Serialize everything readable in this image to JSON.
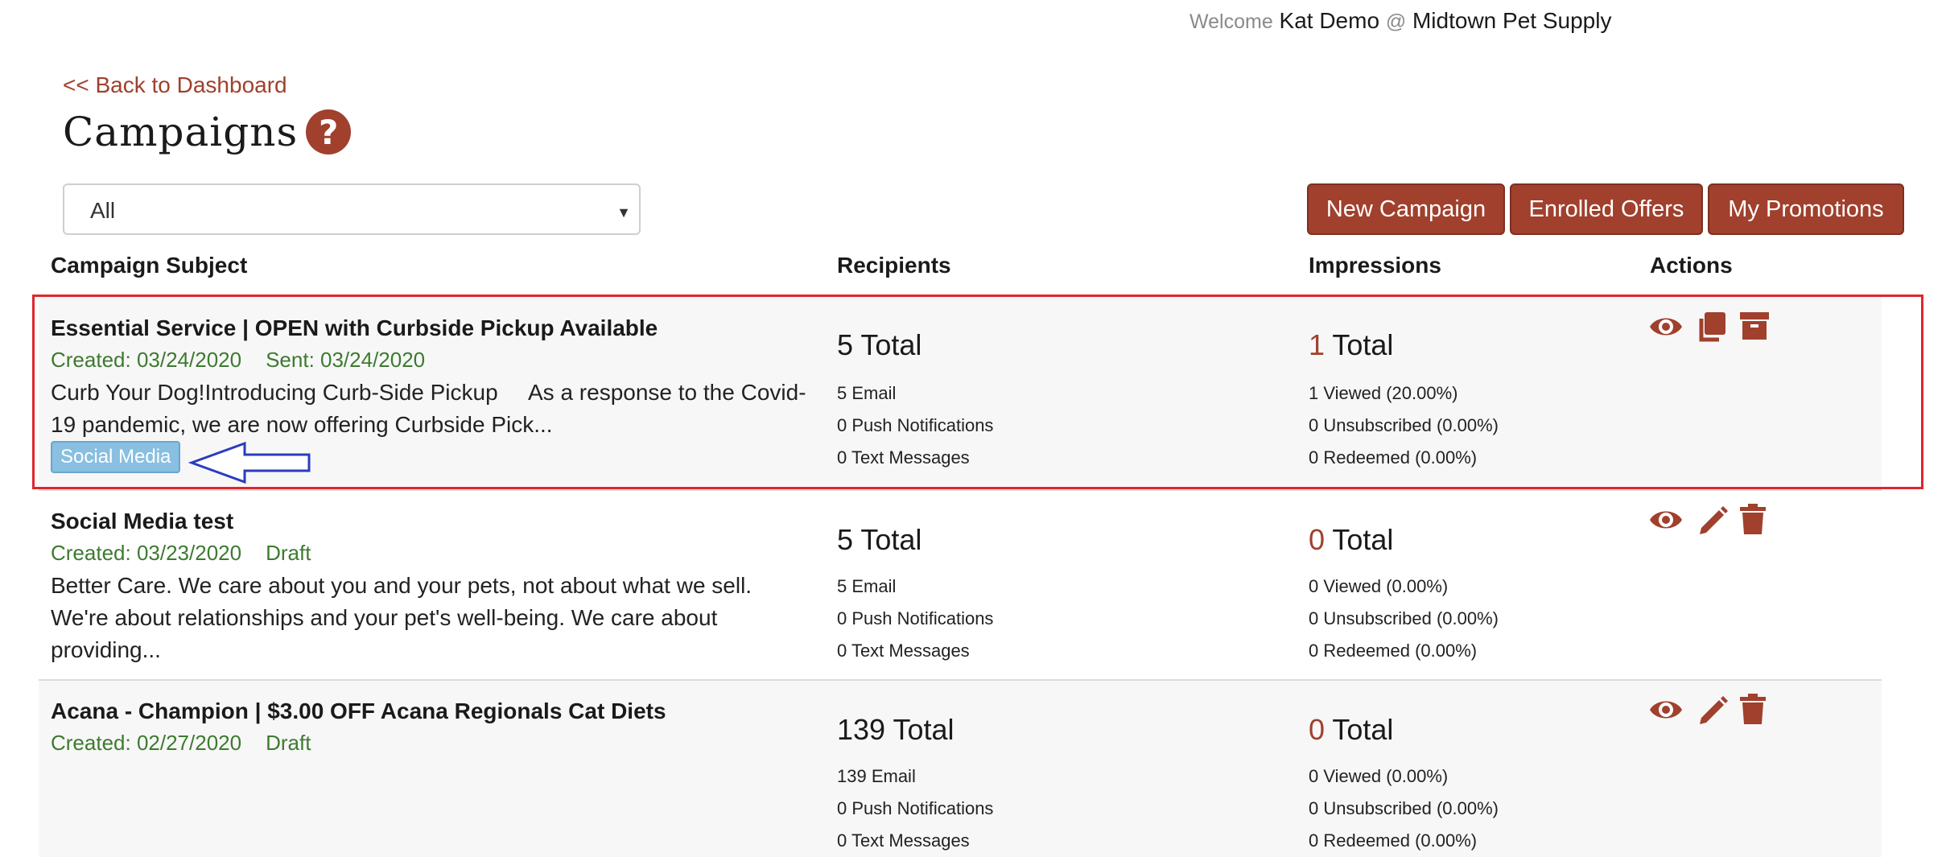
{
  "header": {
    "welcome_label": "Welcome",
    "user_name": "Kat Demo",
    "at_sign": "@",
    "store_name": "Midtown Pet Supply"
  },
  "nav": {
    "back_link": "<< Back to Dashboard"
  },
  "page": {
    "title": "Campaigns"
  },
  "filter": {
    "selected": "All"
  },
  "toolbar": {
    "new_campaign": "New Campaign",
    "enrolled_offers": "Enrolled Offers",
    "my_promotions": "My Promotions"
  },
  "columns": {
    "subject": "Campaign Subject",
    "recipients": "Recipients",
    "impressions": "Impressions",
    "actions": "Actions"
  },
  "campaigns": [
    {
      "subject": "Essential Service | OPEN with Curbside Pickup Available",
      "created": "Created: 03/24/2020",
      "status": "Sent: 03/24/2020",
      "preview_line1": "Curb Your Dog!Introducing Curb-Side Pickup     As a response to the Covid-",
      "preview_line2": "19 pandemic, we are now offering Curbside Pick...",
      "tag": "Social Media",
      "recipients_total_num": "5",
      "recipients_total_label": "Total",
      "email": "5 Email",
      "push": "0 Push Notifications",
      "text": "0 Text Messages",
      "impressions_total_num": "1",
      "impressions_total_label": "Total",
      "viewed": "1 Viewed (20.00%)",
      "unsubscribed": "0 Unsubscribed (0.00%)",
      "redeemed": "0 Redeemed (0.00%)",
      "actions": [
        "eye-icon",
        "copy-icon",
        "archive-icon"
      ]
    },
    {
      "subject": "Social Media test",
      "created": "Created: 03/23/2020",
      "status": "Draft",
      "preview_line1": "Better Care. We care about you and your pets, not about what we sell.",
      "preview_line2": "We're about relationships and your pet's well-being. We care about",
      "preview_line3": "providing...",
      "recipients_total_num": "5",
      "recipients_total_label": "Total",
      "email": "5 Email",
      "push": "0 Push Notifications",
      "text": "0 Text Messages",
      "impressions_total_num": "0",
      "impressions_total_label": "Total",
      "viewed": "0 Viewed (0.00%)",
      "unsubscribed": "0 Unsubscribed (0.00%)",
      "redeemed": "0 Redeemed (0.00%)",
      "actions": [
        "eye-icon",
        "pencil-icon",
        "trash-icon"
      ]
    },
    {
      "subject": "Acana - Champion | $3.00 OFF Acana Regionals Cat Diets",
      "created": "Created: 02/27/2020",
      "status": "Draft",
      "recipients_total_num": "139",
      "recipients_total_label": "Total",
      "email": "139 Email",
      "push": "0 Push Notifications",
      "text": "0 Text Messages",
      "impressions_total_num": "0",
      "impressions_total_label": "Total",
      "viewed": "0 Viewed (0.00%)",
      "unsubscribed": "0 Unsubscribed (0.00%)",
      "redeemed": "0 Redeemed (0.00%)",
      "actions": [
        "eye-icon",
        "pencil-icon",
        "trash-icon"
      ]
    }
  ],
  "colors": {
    "brand": "#a0402d",
    "meta_green": "#3d7a2f",
    "tag_blue": "#89bfe0",
    "highlight_red": "#e0262f",
    "arrow_blue": "#2b3bbf"
  }
}
